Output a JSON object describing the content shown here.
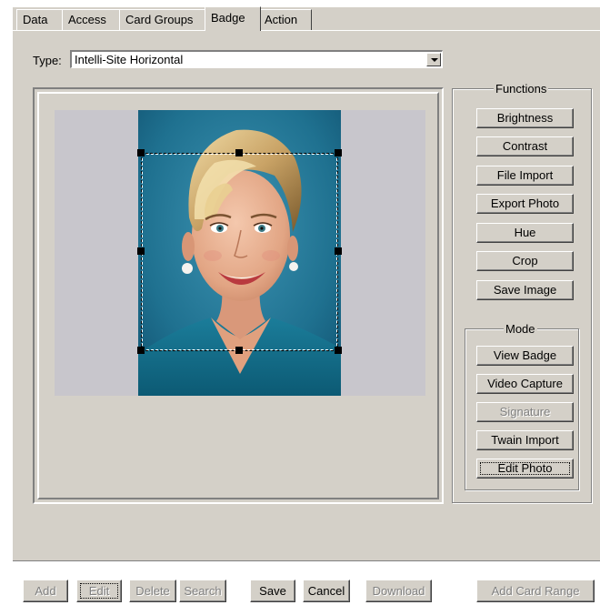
{
  "tabs": [
    "Data",
    "Access",
    "Card Groups",
    "Badge",
    "Action"
  ],
  "active_tab": "Badge",
  "type_field": {
    "label": "Type:",
    "value": "Intelli-Site Horizontal"
  },
  "functions": {
    "title": "Functions",
    "buttons": [
      "Brightness",
      "Contrast",
      "File Import",
      "Export Photo",
      "Hue",
      "Crop",
      "Save Image"
    ]
  },
  "mode": {
    "title": "Mode",
    "buttons": [
      "View Badge",
      "Video Capture",
      "Signature",
      "Twain Import",
      "Edit Photo"
    ],
    "disabled": [
      "Signature"
    ],
    "active": "Edit Photo"
  },
  "bottom_bar": {
    "add": "Add",
    "edit": "Edit",
    "delete": "Delete",
    "search": "Search",
    "save": "Save",
    "cancel": "Cancel",
    "download": "Download",
    "add_card_range": "Add Card Range"
  }
}
